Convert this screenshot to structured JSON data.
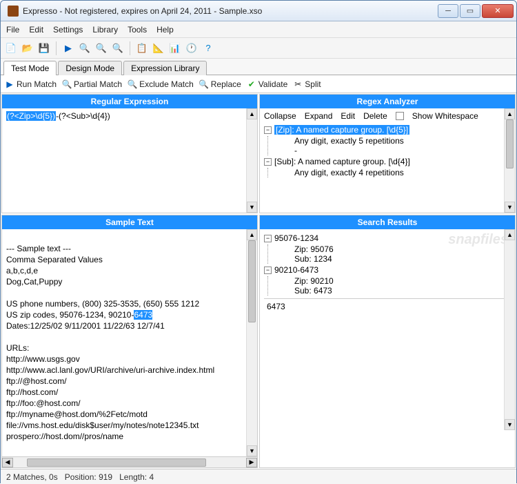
{
  "window": {
    "title": "Expresso - Not registered, expires on April 24, 2011 - Sample.xso"
  },
  "menubar": [
    "File",
    "Edit",
    "Settings",
    "Library",
    "Tools",
    "Help"
  ],
  "tabs": {
    "items": [
      "Test Mode",
      "Design Mode",
      "Expression Library"
    ],
    "active": 0
  },
  "actions": {
    "run_match": "Run Match",
    "partial_match": "Partial Match",
    "exclude_match": "Exclude Match",
    "replace": "Replace",
    "validate": "Validate",
    "split": "Split"
  },
  "panels": {
    "regex_title": "Regular Expression",
    "analyzer_title": "Regex Analyzer",
    "sample_title": "Sample Text",
    "results_title": "Search Results"
  },
  "regex": {
    "highlighted": "(?<Zip>\\d{5})",
    "rest": "-(?<Sub>\\d{4})"
  },
  "analyzer": {
    "actions": {
      "collapse": "Collapse",
      "expand": "Expand",
      "edit": "Edit",
      "delete": "Delete",
      "show_ws": "Show Whitespace"
    },
    "tree": {
      "n1": "[Zip]: A named capture group. [\\d{5}]",
      "n1c": "Any digit, exactly 5 repetitions",
      "dash": "-",
      "n2": "[Sub]: A named capture group. [\\d{4}]",
      "n2c": "Any digit, exactly 4 repetitions"
    }
  },
  "sample": {
    "line1": "--- Sample text ---",
    "line2": "Comma Separated Values",
    "line3": "a,b,c,d,e",
    "line4": "Dog,Cat,Puppy",
    "line5": "US phone numbers, (800) 325-3535, (650) 555 1212",
    "line6_pre": "US zip codes, 95076-1234, 90210-",
    "line6_sel": "6473",
    "line7": "Dates:12/25/02 9/11/2001 11/22/63 12/7/41",
    "line8": "URLs:",
    "line9": "http://www.usgs.gov",
    "line10": "http://www.acl.lanl.gov/URI/archive/uri-archive.index.html",
    "line11": "ftp://@host.com/",
    "line12": "ftp://host.com/",
    "line13": "ftp://foo:@host.com/",
    "line14": "ftp://myname@host.dom/%2Fetc/motd",
    "line15": "file://vms.host.edu/disk$user/my/notes/note12345.txt",
    "line16": "prospero://host.dom//pros/name"
  },
  "results": {
    "r1": "95076-1234",
    "r1a": "Zip: 95076",
    "r1b": "Sub: 1234",
    "r2": "90210-6473",
    "r2a": "Zip: 90210",
    "r2b": "Sub: 6473",
    "selected_text": "6473"
  },
  "status": {
    "matches": "2 Matches, 0s",
    "position": "Position: 919",
    "length": "Length: 4"
  },
  "watermark": "snapfiles"
}
